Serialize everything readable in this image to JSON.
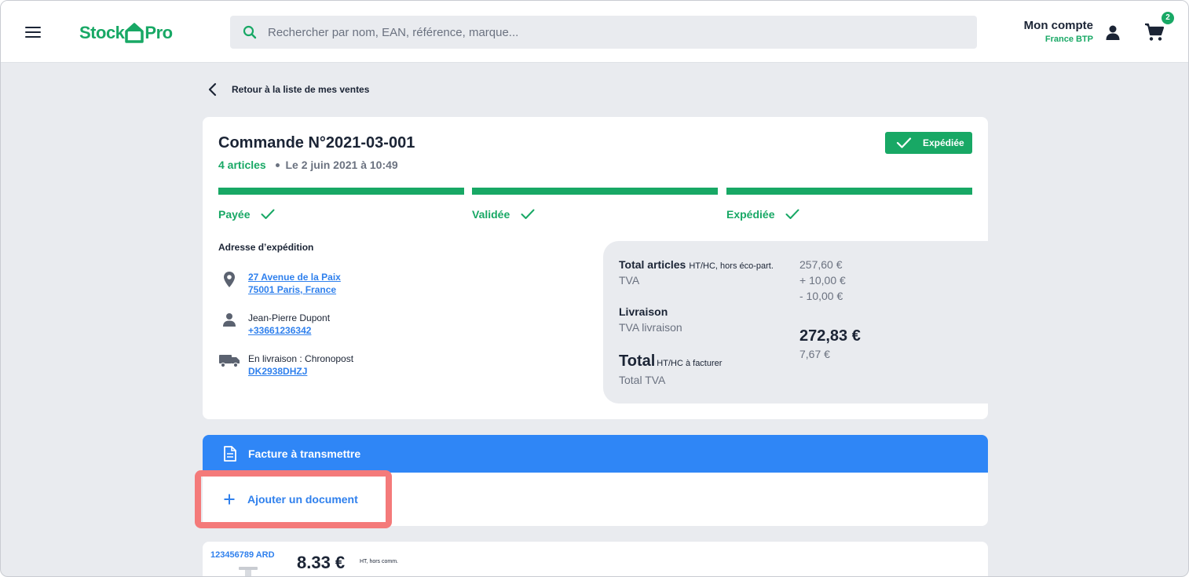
{
  "header": {
    "logo_left": "Stock",
    "logo_right": "Pro",
    "search_placeholder": "Rechercher par nom, EAN, référence, marque...",
    "account_title": "Mon compte",
    "account_company": "France BTP",
    "cart_count": "2"
  },
  "back_link": "Retour à la liste de mes ventes",
  "order": {
    "title": "Commande N°2021-03-001",
    "articles": "4 articles",
    "date": "Le 2 juin 2021 à 10:49",
    "status": "Expédiée",
    "steps": [
      {
        "label": "Payée"
      },
      {
        "label": "Validée"
      },
      {
        "label": "Expédiée"
      }
    ],
    "shipping": {
      "title": "Adresse d’expédition",
      "address_line1": "27 Avenue de la Paix",
      "address_line2": "75001 Paris, France",
      "contact_name": "Jean-Pierre Dupont",
      "contact_phone": "+33661236342",
      "delivery_text": "En livraison : Chronopost",
      "tracking": "DK2938DHZJ"
    },
    "totals": {
      "articles_label": "Total articles",
      "articles_note": "HT/HC, hors éco-part.",
      "tva_label": "TVA",
      "delivery_label": "Livraison",
      "delivery_tva_label": "TVA livraison",
      "total_label": "Total",
      "total_note": "HT/HC à facturer",
      "total_tva_label": "Total TVA",
      "articles_value": "257,60 €",
      "tva_value": "+ 10,00 €",
      "delivery_value": "- 10,00 €",
      "total_value": "272,83 €",
      "total_tva_value": "7,67 €"
    }
  },
  "documents": {
    "header": "Facture à transmettre",
    "add_label": "Ajouter un document"
  },
  "product": {
    "ref": "123456789 ARD",
    "price": "8.33 €",
    "price_note": "HT, hors comm."
  },
  "colors": {
    "brand_green": "#18a865",
    "accent_blue": "#2f86f6",
    "highlight": "#f47a7a"
  }
}
